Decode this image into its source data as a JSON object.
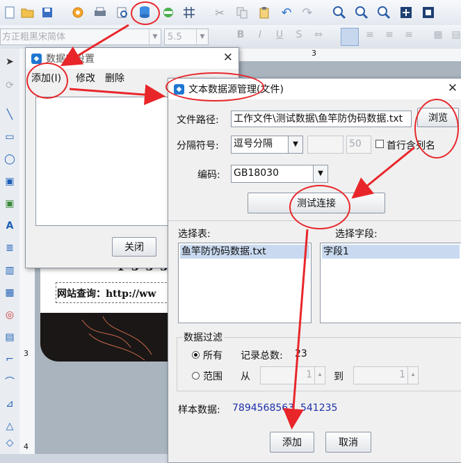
{
  "main_toolbar": {
    "icons": [
      "new-icon",
      "open-icon",
      "save-icon",
      "settings-icon",
      "print-icon",
      "print-preview-icon",
      "database-icon",
      "grid-icon",
      "lines-icon",
      "cut-icon",
      "copy-icon",
      "paste-icon",
      "undo-icon",
      "redo-icon",
      "zoom-in-icon",
      "zoom-out-icon",
      "zoom-fit-icon",
      "zoom-page-icon",
      "fullscreen-icon"
    ]
  },
  "format_toolbar": {
    "font_family": "方正粗黑宋简体",
    "font_size": "5.5"
  },
  "canvas": {
    "ruler_top_mark": "3",
    "ruler_left_mark_1": "3",
    "ruler_left_mark_2": "4",
    "label_line_1": "1 3 3 3",
    "label_line_2": "网站查询：http://ww"
  },
  "db_manager": {
    "title": "数据库设置",
    "menu_add": "添加(I)",
    "menu_edit": "修改",
    "menu_delete": "删除",
    "close_button": "关闭"
  },
  "text_source": {
    "title": "文本数据源管理(文件)",
    "file_path_label": "文件路径:",
    "file_path_value": "工作文件\\测试数据\\鱼竿防伪码数据.txt",
    "browse_button": "浏览",
    "separator_label": "分隔符号:",
    "separator_value": "逗号分隔",
    "separator_length": "50",
    "first_row_header_label": "首行含列名",
    "encoding_label": "编码:",
    "encoding_value": "GB18030",
    "test_connection_button": "测试连接",
    "select_table_label": "选择表:",
    "table_item": "鱼竿防伪码数据.txt",
    "select_field_label": "选择字段:",
    "field_item": "字段1",
    "filter_group_label": "数据过滤",
    "filter_all_label": "所有",
    "record_count_label": "记录总数:",
    "record_count_value": "23",
    "filter_range_label": "范围",
    "range_from_label": "从",
    "range_from_value": "1",
    "range_to_label": "到",
    "range_to_value": "1",
    "sample_label": "样本数据:",
    "sample_value": "7894568563  541235",
    "add_button": "添加",
    "cancel_button": "取消"
  },
  "colors": {
    "annotation_red": "#e8262a",
    "sample_blue": "#1d2fa8",
    "selection": "#c9daf0"
  }
}
